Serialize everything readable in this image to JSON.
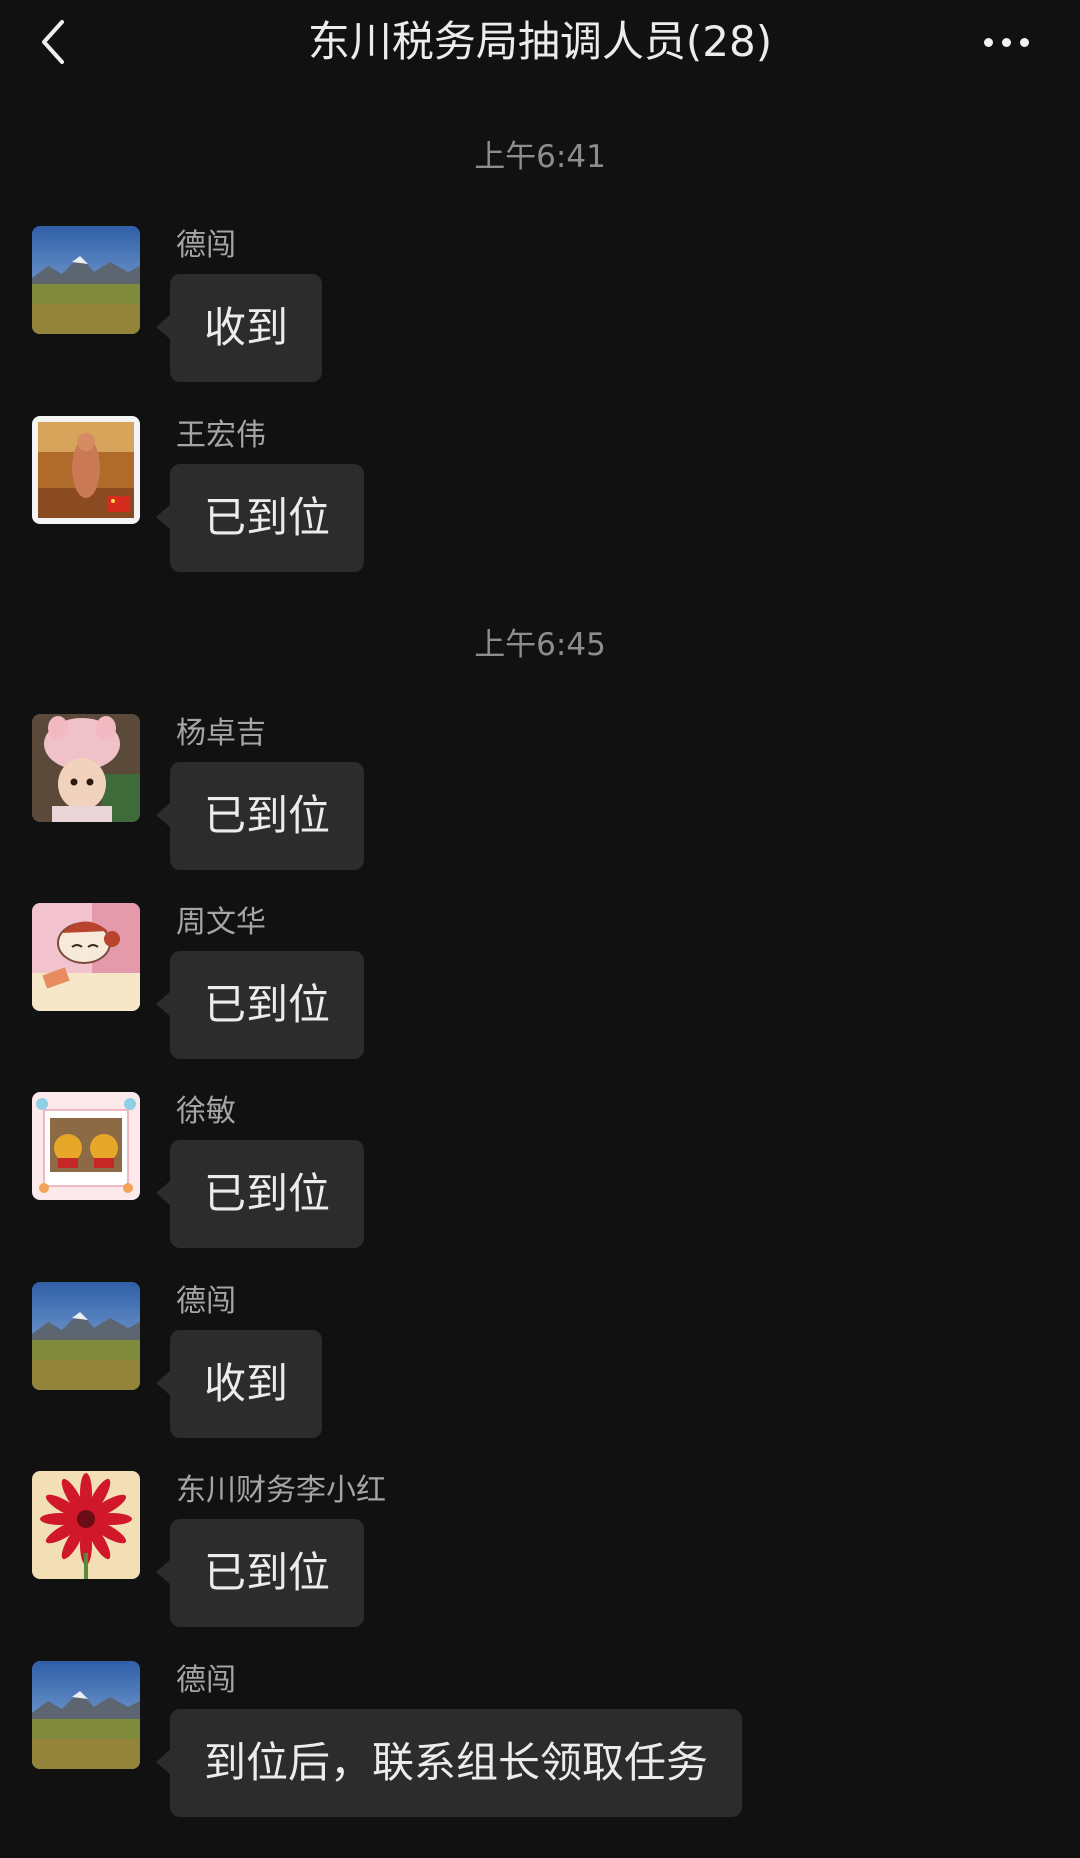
{
  "header": {
    "title": "东川税务局抽调人员(28)",
    "back_icon": "chevron-left-icon",
    "more_icon": "more-dots-icon"
  },
  "timestamps": [
    "上午6:41",
    "上午6:45"
  ],
  "messages": [
    {
      "sender": "德闯",
      "text": "收到",
      "avatar": "mountain-meadow"
    },
    {
      "sender": "王宏伟",
      "text": "已到位",
      "avatar": "statue-indoor"
    },
    {
      "sender": "杨卓吉",
      "text": "已到位",
      "avatar": "child-pink-hat"
    },
    {
      "sender": "周文华",
      "text": "已到位",
      "avatar": "cartoon-girl"
    },
    {
      "sender": "徐敏",
      "text": "已到位",
      "avatar": "bears-photo"
    },
    {
      "sender": "德闯",
      "text": "收到",
      "avatar": "mountain-meadow"
    },
    {
      "sender": "东川财务李小红",
      "text": "已到位",
      "avatar": "red-flower"
    },
    {
      "sender": "德闯",
      "text": "到位后，联系组长领取任务",
      "avatar": "mountain-meadow"
    }
  ],
  "colors": {
    "background": "#111111",
    "bubble": "#2c2c2c",
    "text": "#ececec",
    "secondary_text": "#a5a5a5"
  }
}
